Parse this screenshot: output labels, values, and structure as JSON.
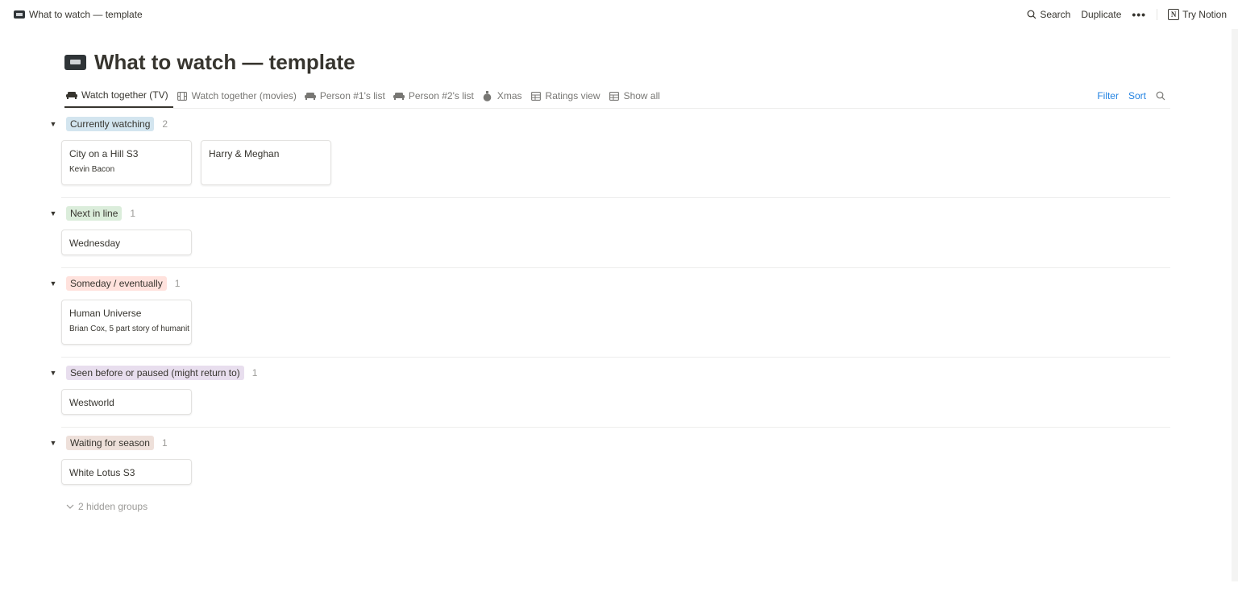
{
  "topbar": {
    "page_title": "What to watch — template",
    "search_label": "Search",
    "duplicate_label": "Duplicate",
    "more_label": "•••",
    "try_label": "Try Notion",
    "logo_letter": "N"
  },
  "page": {
    "title": "What to watch — template"
  },
  "tabs": [
    {
      "label": "Watch together (TV)",
      "icon": "sofa-icon",
      "active": true
    },
    {
      "label": "Watch together (movies)",
      "icon": "film-icon",
      "active": false
    },
    {
      "label": "Person #1's list",
      "icon": "sofa-icon",
      "active": false
    },
    {
      "label": "Person #2's list",
      "icon": "sofa-icon",
      "active": false
    },
    {
      "label": "Xmas",
      "icon": "ornament-icon",
      "active": false
    },
    {
      "label": "Ratings view",
      "icon": "table-icon",
      "active": false
    },
    {
      "label": "Show all",
      "icon": "table-icon",
      "active": false
    }
  ],
  "actions": {
    "filter": "Filter",
    "sort": "Sort"
  },
  "colors": {
    "link_blue": "#2383e2",
    "tag_blue": "#d3e5ef",
    "tag_green": "#dbeddb",
    "tag_red": "#ffe2dd",
    "tag_purple": "#e8deee",
    "tag_brown": "#eee0da"
  },
  "groups": [
    {
      "name": "Currently watching",
      "count": "2",
      "color": "#d3e5ef",
      "cards": [
        {
          "title": "City on a Hill S3",
          "sub": "Kevin Bacon"
        },
        {
          "title": "Harry & Meghan",
          "sub": ""
        }
      ]
    },
    {
      "name": "Next in line",
      "count": "1",
      "color": "#dbeddb",
      "cards": [
        {
          "title": "Wednesday",
          "sub": ""
        }
      ]
    },
    {
      "name": "Someday / eventually",
      "count": "1",
      "color": "#ffe2dd",
      "cards": [
        {
          "title": "Human Universe",
          "sub": "Brian Cox, 5 part story of humanit"
        }
      ]
    },
    {
      "name": "Seen before or paused (might return to)",
      "count": "1",
      "color": "#e8deee",
      "cards": [
        {
          "title": "Westworld",
          "sub": ""
        }
      ]
    },
    {
      "name": "Waiting for season",
      "count": "1",
      "color": "#eee0da",
      "cards": [
        {
          "title": "White Lotus S3",
          "sub": ""
        }
      ]
    }
  ],
  "hidden_groups": "2 hidden groups"
}
